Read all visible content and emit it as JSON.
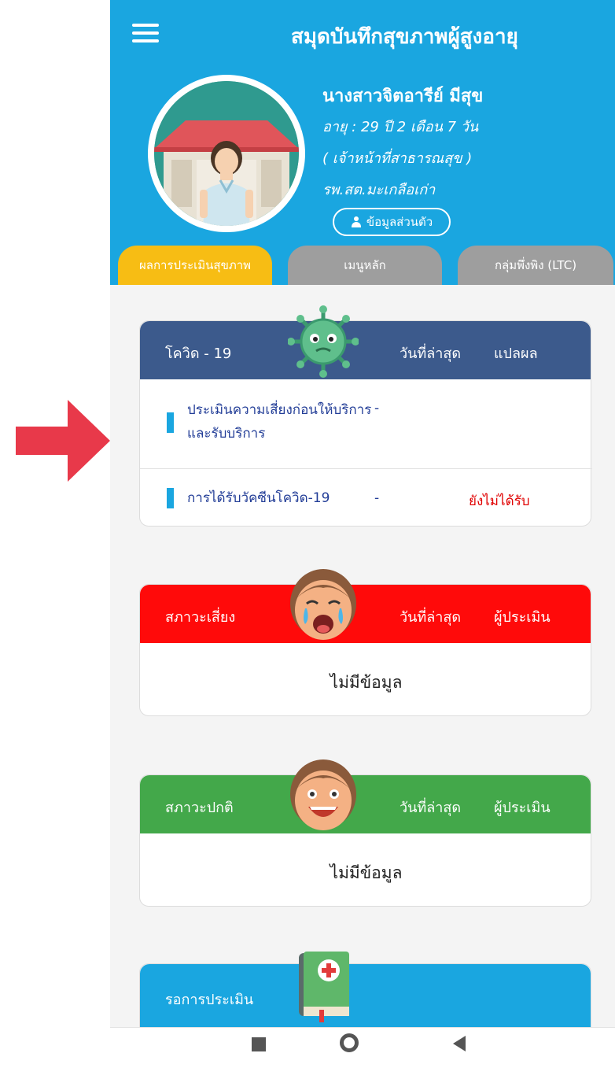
{
  "header": {
    "title": "สมุดบันทึกสุขภาพผู้สูงอายุ",
    "menu_icon": "hamburger-menu-icon"
  },
  "profile": {
    "name": "นางสาวจิตอารีย์ มีสุข",
    "age": "อายุ : 29 ปี 2 เดือน 7 วัน",
    "position": "( เจ้าหน้าที่สาธารณสุข )",
    "organization": "รพ.สต.มะเกลือเก่า",
    "button_label": "ข้อมูลส่วนตัว"
  },
  "tabs": [
    {
      "label": "ผลการประเมินสุขภาพ",
      "active": true
    },
    {
      "label": "เมนูหลัก",
      "active": false
    },
    {
      "label": "กลุ่มพึ่งพิง (LTC)",
      "active": false
    }
  ],
  "covid": {
    "title": "โควิด - 19",
    "col_date": "วันที่ล่าสุด",
    "col_result": "แปลผล",
    "items": [
      {
        "label": "ประเมินความเสี่ยงก่อนให้บริการและรับบริการ",
        "date": "-",
        "result": ""
      },
      {
        "label": "การได้รับวัคซีนโควิด-19",
        "date": "-",
        "result": "ยังไม่ได้รับ"
      }
    ]
  },
  "risk": {
    "title": "สภาวะเสี่ยง",
    "col_date": "วันที่ล่าสุด",
    "col_assessor": "ผู้ประเมิน",
    "empty": "ไม่มีข้อมูล"
  },
  "normal": {
    "title": "สภาวะปกติ",
    "col_date": "วันที่ล่าสุด",
    "col_assessor": "ผู้ประเมิน",
    "empty": "ไม่มีข้อมูล"
  },
  "waiting": {
    "title": "รอการประเมิน"
  },
  "colors": {
    "header_blue": "#1aa6e0",
    "tab_active": "#f7bd14",
    "tab_inactive": "#9e9e9e",
    "covid_header": "#3c5a8c",
    "risk_header": "#ff0a0a",
    "normal_header": "#43a84a",
    "result_red": "#e00000",
    "arrow_red": "#e8394a"
  }
}
